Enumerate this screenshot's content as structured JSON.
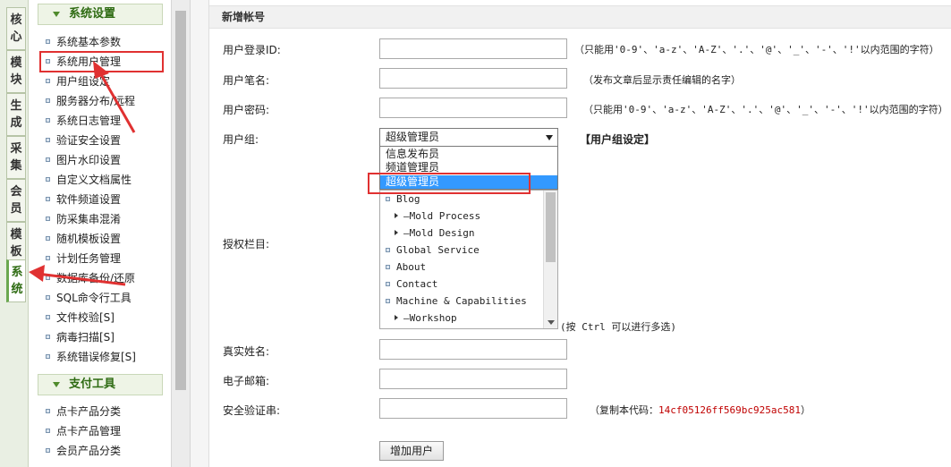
{
  "tabs": [
    "核心",
    "模块",
    "生成",
    "采集",
    "会员",
    "模板",
    "系统"
  ],
  "sections": [
    {
      "title": "系统设置",
      "items": [
        "系统基本参数",
        "系统用户管理",
        "用户组设定",
        "服务器分布/远程",
        "系统日志管理",
        "验证安全设置",
        "图片水印设置",
        "自定义文档属性",
        "软件频道设置",
        "防采集串混淆",
        "随机模板设置",
        "计划任务管理",
        "数据库备份/还原",
        "SQL命令行工具",
        "文件校验[S]",
        "病毒扫描[S]",
        "系统错误修复[S]"
      ]
    },
    {
      "title": "支付工具",
      "items": [
        "点卡产品分类",
        "点卡产品管理",
        "会员产品分类"
      ]
    }
  ],
  "form": {
    "title": "新增帐号",
    "login_id_label": "用户登录ID:",
    "login_id_hint": "（只能用'0-9'、'a-z'、'A-Z'、'.'、'@'、'_'、'-'、'!'以内范围的字符）",
    "pen_name_label": "用户笔名:",
    "pen_name_hint": "（发布文章后显示责任编辑的名字）",
    "password_label": "用户密码:",
    "password_hint": "（只能用'0-9'、'a-z'、'A-Z'、'.'、'@'、'_'、'-'、'!'以内范围的字符）",
    "group_label": "用户组:",
    "group_selected": "超级管理员",
    "group_options": [
      "信息发布员",
      "频道管理员",
      "超级管理员"
    ],
    "group_link": "【用户组设定】",
    "columns_label": "授权栏目:",
    "columns": [
      {
        "text": "Blog",
        "level": 0
      },
      {
        "text": "—Mold Process",
        "level": 1
      },
      {
        "text": "—Mold Design",
        "level": 1
      },
      {
        "text": "Global Service",
        "level": 0
      },
      {
        "text": "About",
        "level": 0
      },
      {
        "text": "Contact",
        "level": 0
      },
      {
        "text": "Machine & Capabilities",
        "level": 0
      },
      {
        "text": "—Workshop",
        "level": 1
      }
    ],
    "columns_hint": "(按 Ctrl 可以进行多选)",
    "realname_label": "真实姓名:",
    "email_label": "电子邮箱:",
    "safecode_label": "安全验证串:",
    "safecode_hint_prefix": "（复制本代码：",
    "safecode_value": "14cf05126ff569bc925ac581",
    "safecode_hint_suffix": "）",
    "submit_label": "增加用户"
  },
  "colors": {
    "accent": "#2e6b12",
    "annotation": "#e03131",
    "selected_option": "#3399ff",
    "code": "#c00000"
  }
}
